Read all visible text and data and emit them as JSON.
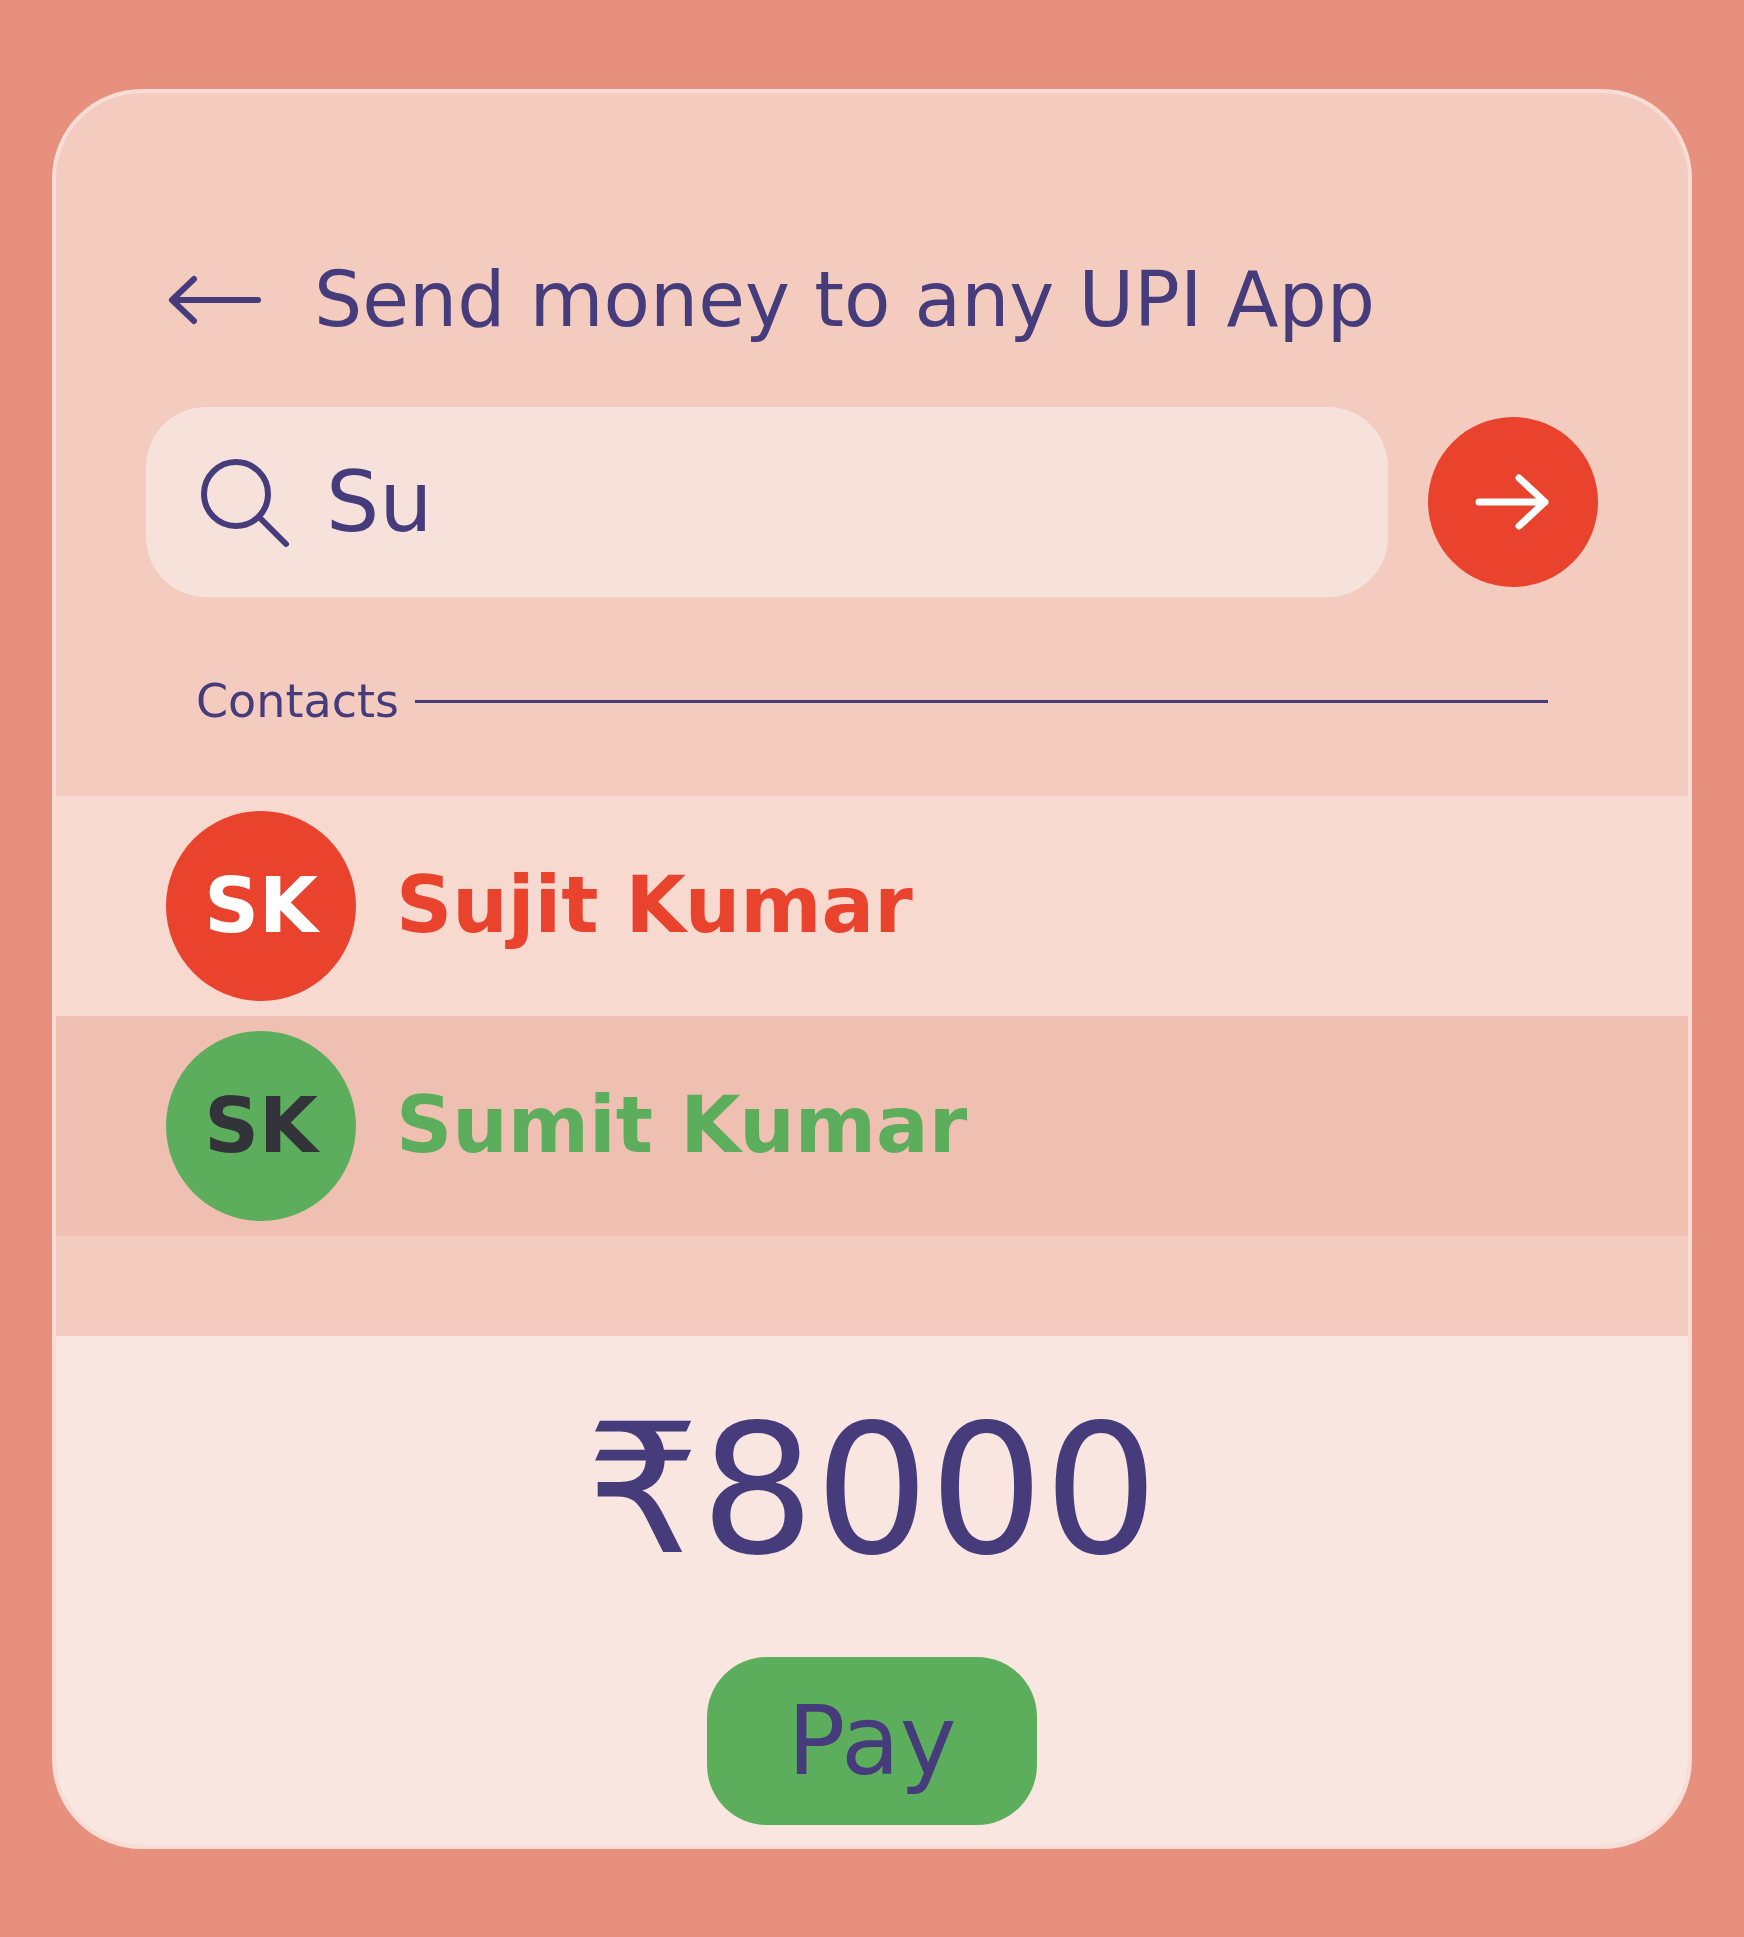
{
  "header": {
    "title": "Send money to any UPI App"
  },
  "search": {
    "value": "Su"
  },
  "contacts_label": "Contacts",
  "contacts": [
    {
      "initials": "SK",
      "name": "Sujit Kumar",
      "color": "#e9432e",
      "selected": true
    },
    {
      "initials": "SK",
      "name": "Sumit Kumar",
      "color": "#5cae5c",
      "selected": false
    }
  ],
  "amount": "₹8000",
  "pay_button": "Pay"
}
